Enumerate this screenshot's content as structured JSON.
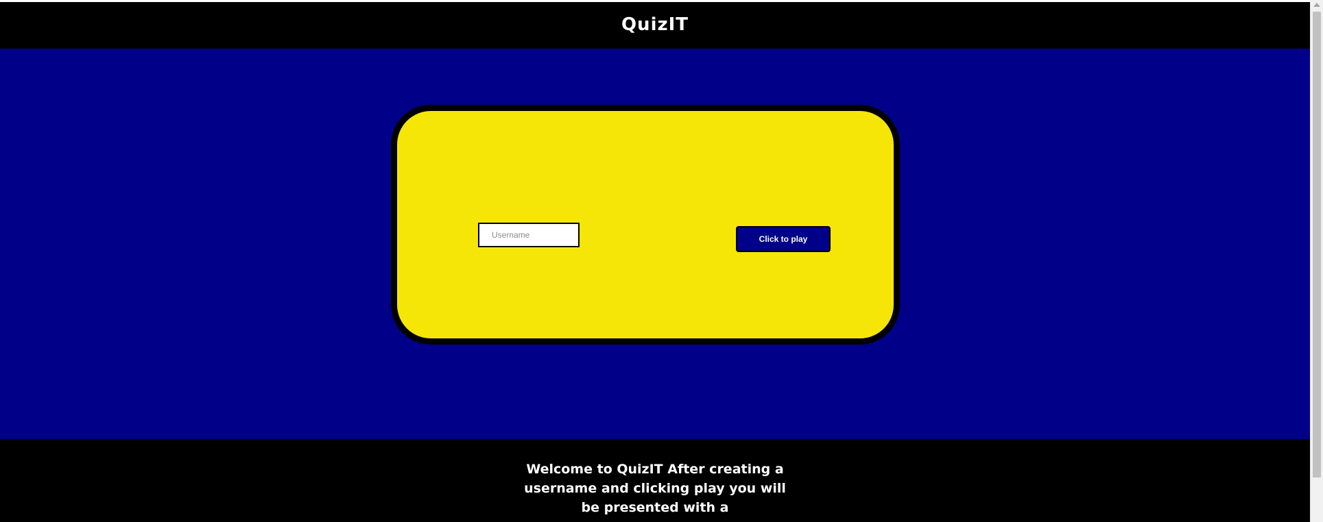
{
  "header": {
    "title": "QuizIT"
  },
  "login_card": {
    "username_input": {
      "value": "",
      "placeholder": "Username"
    },
    "play_button_label": "Click to play"
  },
  "footer": {
    "welcome_text": "Welcome to QuizIT After creating a username and clicking play you will be presented with a"
  },
  "colors": {
    "header_bg": "#000000",
    "main_bg": "#000088",
    "card_bg": "#f5e607",
    "card_border": "#000000",
    "button_bg": "#000088",
    "text_light": "#ffffff"
  },
  "icons": {
    "scrollbar_up": "scroll-up-arrow-icon"
  }
}
